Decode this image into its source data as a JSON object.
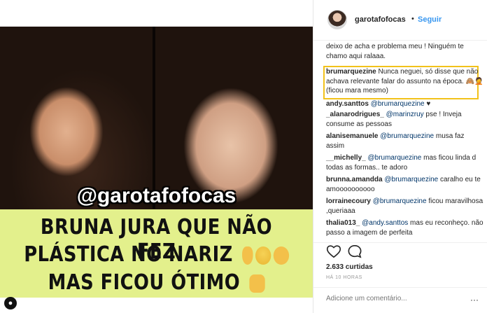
{
  "photo": {
    "handle": "@garotafofocas",
    "line1": "BRUNA JURA QUE NÃO FEZ",
    "line2": "PLÁSTICA NO NARIZ",
    "line3": "MAS FICOU ÓTIMO"
  },
  "header": {
    "username": "garotafofocas",
    "separator": "•",
    "follow_label": "Seguir"
  },
  "comments": [
    {
      "text": "deixo de acha e problema meu ! Ninguém te chamo aqui ralaaa."
    },
    {
      "user": "brumarquezine",
      "text": " Nunca neguei, só disse que não achava relevante falar do assunto na época. 🙈🤦 (ficou mara mesmo)"
    },
    {
      "user": "andy.santtos",
      "mention": "@brumarquezine",
      "text": " ♥"
    },
    {
      "user": "_alanarodrigues_",
      "mention": "@marinzruy",
      "text": " pse ! Inveja consume as pessoas"
    },
    {
      "user": "alanisemanuele",
      "mention": "@brumarquezine",
      "text": " musa faz assim"
    },
    {
      "user": "__michelly_",
      "mention": "@brumarquezine",
      "text": " mas ficou linda d todas as formas.. te adoro"
    },
    {
      "user": "brunna.amandda",
      "mention": "@brumarquezine",
      "text": " caralho eu te amoooooooooo"
    },
    {
      "user": "lorrainecoury",
      "mention": "@brumarquezine",
      "text": " ficou maravilhosa ,queriaaa"
    },
    {
      "user": "thalia013_",
      "mention": "@andy.santtos",
      "text": " mas eu reconheço. não passo a imagem de perfeita"
    }
  ],
  "likes": "2.633 curtidas",
  "time": "HÁ 10 HORAS",
  "add_comment": {
    "placeholder": "Adicione um comentário..."
  },
  "more_label": "···",
  "colors": {
    "accent": "#3897f0",
    "highlight": "#f2c21b",
    "banner": "#e3f08c"
  }
}
